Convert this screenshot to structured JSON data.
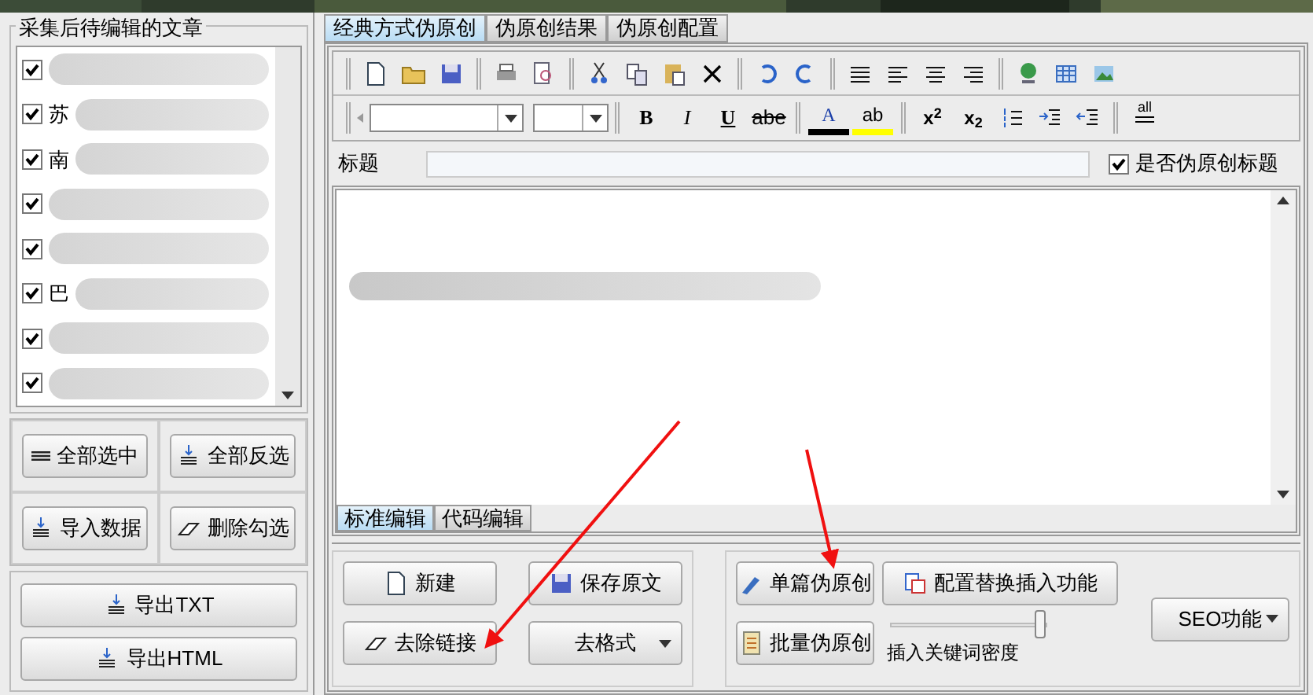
{
  "articles": {
    "title": "采集后待编辑的文章",
    "items": [
      {
        "checked": true
      },
      {
        "checked": true,
        "text": "苏"
      },
      {
        "checked": true,
        "text": "南"
      },
      {
        "checked": true
      },
      {
        "checked": true
      },
      {
        "checked": true,
        "text": "巴"
      },
      {
        "checked": true
      },
      {
        "checked": true
      }
    ]
  },
  "list_buttons": [
    {
      "label": "全部选中"
    },
    {
      "label": "全部反选"
    },
    {
      "label": "导入数据"
    },
    {
      "label": "删除勾选"
    }
  ],
  "export_buttons": [
    {
      "label": "导出TXT"
    },
    {
      "label": "导出HTML"
    }
  ],
  "tabs": [
    {
      "label": "经典方式伪原创",
      "selected": true
    },
    {
      "label": "伪原创结果",
      "selected": false
    },
    {
      "label": "伪原创配置",
      "selected": false
    }
  ],
  "format_toolbar": [
    {
      "kind": "bold",
      "text": "B"
    },
    {
      "kind": "italic",
      "text": "I"
    },
    {
      "kind": "underline",
      "text": "U"
    },
    {
      "kind": "strike",
      "text": "abe"
    }
  ],
  "color_toolbar": [
    {
      "kind": "font",
      "text": "A"
    },
    {
      "kind": "highlight",
      "text": "ab"
    }
  ],
  "script_toolbar": [
    "x$^{2}$",
    "x$_{2}$"
  ],
  "all_icon_text": "all",
  "title_row": {
    "label": "标题",
    "checkbox": {
      "label": "是否伪原创标题",
      "checked": true
    }
  },
  "editor_tabs": [
    {
      "label": "标准编辑",
      "selected": true
    },
    {
      "label": "代码编辑",
      "selected": false
    }
  ],
  "actions": {
    "new": "新建",
    "save": "保存原文",
    "remove_links": "去除链接",
    "format": "去格式"
  },
  "pseudo": {
    "single": "单篇伪原创",
    "batch": "批量伪原创",
    "config": "配置替换插入功能",
    "seo": "SEO功能",
    "density": {
      "label": "插入关键词密度",
      "level": 0.95
    }
  }
}
